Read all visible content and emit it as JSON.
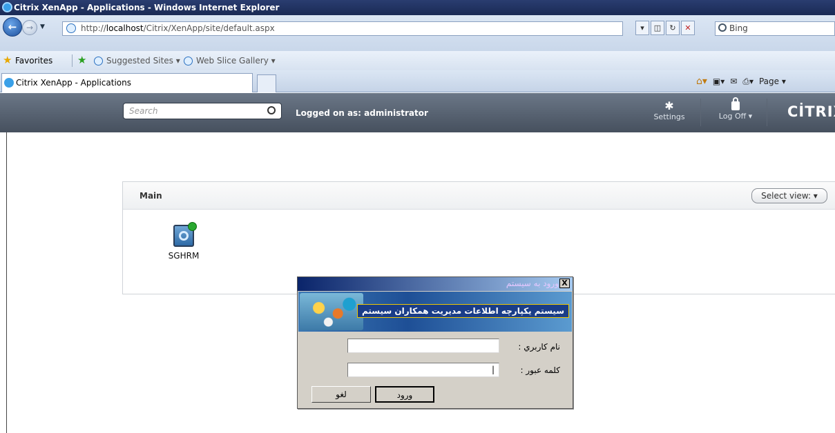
{
  "browser": {
    "window_title": "Citrix XenApp - Applications - Windows Internet Explorer",
    "address_prefix": "http://",
    "address_host": "localhost",
    "address_path": "/Citrix/XenApp/site/default.aspx",
    "search_placeholder": "Bing",
    "favorites_label": "Favorites",
    "fav_links": [
      "Suggested Sites ▾",
      "Web Slice Gallery ▾"
    ],
    "tab_title": "Citrix XenApp - Applications",
    "page_menu": "Page ▾"
  },
  "citrix": {
    "search_placeholder": "Search",
    "logged_on": "Logged on as: administrator",
    "settings_label": "Settings",
    "logoff_label": "Log Off ▾",
    "logo": "CİTRIX"
  },
  "panel": {
    "title": "Main",
    "select_view": "Select view: ▾",
    "apps": [
      {
        "name": "SGHRM"
      }
    ]
  },
  "dialog": {
    "title": "ورود به سيستم",
    "close": "X",
    "banner_text": "سیستم یکپارچه اطلاعات مدیریت همکاران سیستم",
    "username_label": "نام کاربري :",
    "username_value": "",
    "password_label": "کلمه عبور :",
    "password_value": "|",
    "login_button": "ورود",
    "cancel_button": "لغو"
  }
}
